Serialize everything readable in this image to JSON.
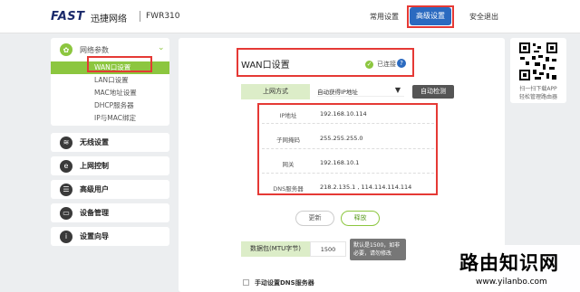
{
  "header": {
    "logo": "FAST",
    "brand": "迅捷网络",
    "model": "FWR310",
    "nav_common": "常用设置",
    "nav_advanced": "高级设置",
    "nav_logout": "安全退出"
  },
  "sidebar": {
    "network_params": "网络参数",
    "subitems": [
      "WAN口设置",
      "LAN口设置",
      "MAC地址设置",
      "DHCP服务器",
      "IP与MAC绑定"
    ],
    "items": [
      "无线设置",
      "上网控制",
      "高级用户",
      "设备管理",
      "设置向导"
    ]
  },
  "panel": {
    "title": "WAN口设置",
    "status": "已连接",
    "conn_label": "上网方式",
    "conn_value": "自动获得IP地址",
    "auto_detect": "自动检测",
    "ip_label": "IP地址",
    "ip_value": "192.168.10.114",
    "mask_label": "子网掩码",
    "mask_value": "255.255.255.0",
    "gw_label": "网关",
    "gw_value": "192.168.10.1",
    "dns_label": "DNS服务器",
    "dns_value": "218.2.135.1 , 114.114.114.114",
    "refresh": "更新",
    "release": "释放",
    "mtu_label": "数据包(MTU字节)",
    "mtu_value": "1500",
    "mtu_note1": "默认是1500，如非",
    "mtu_note2": "必要，请勿修改",
    "dns_manual": "手动设置DNS服务器"
  },
  "qr": {
    "line1": "扫一扫下载APP",
    "line2": "轻松管理路由器"
  },
  "watermark": {
    "title": "路由知识网",
    "url": "www.yilanbo.com"
  }
}
